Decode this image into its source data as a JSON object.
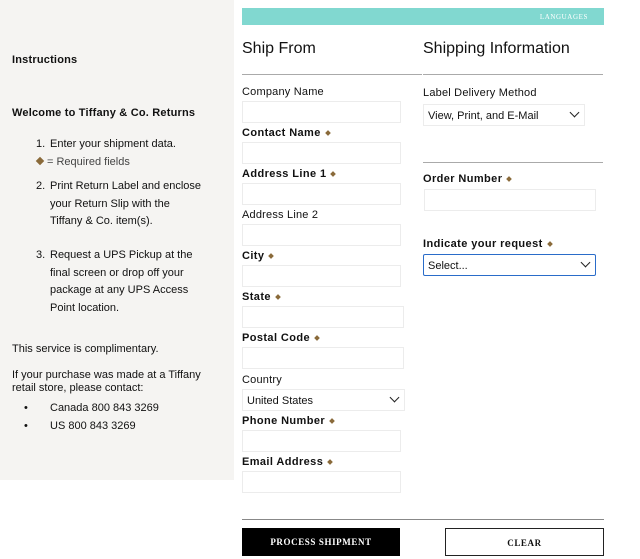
{
  "sidebar": {
    "instructions_title": "Instructions",
    "welcome_title": "Welcome to Tiffany & Co. Returns",
    "steps": [
      {
        "num": "1.",
        "lines": [
          "Enter your shipment data."
        ]
      },
      {
        "num": "2.",
        "lines": [
          "Print Return Label and enclose",
          "your Return Slip with the",
          "Tiffany & Co. item(s)."
        ]
      },
      {
        "num": "3.",
        "lines": [
          "Request a UPS Pickup at the",
          "final screen or drop off your",
          "package at any UPS Access",
          "Point location."
        ]
      }
    ],
    "required_note": "= Required fields",
    "complimentary": "This service is complimentary.",
    "retail_note_line1": "If your purchase was made at a Tiffany",
    "retail_note_line2": "retail store, please contact:",
    "contacts": [
      "Canada 800 843 3269",
      "US 800 843 3269"
    ]
  },
  "topbar": {
    "languages_label": "LANGUAGES",
    "color": "#81d8d0"
  },
  "ship_from": {
    "title": "Ship From",
    "company_name_label": "Company Name",
    "contact_name_label": "Contact Name",
    "address1_label": "Address Line 1",
    "address2_label": "Address Line 2",
    "city_label": "City",
    "state_label": "State",
    "postal_label": "Postal Code",
    "country_label": "Country",
    "country_value": "United States",
    "phone_label": "Phone Number",
    "email_label": "Email Address"
  },
  "shipping_info": {
    "title": "Shipping Information",
    "label_delivery_label": "Label Delivery Method",
    "label_delivery_value": "View, Print, and E-Mail",
    "order_number_label": "Order Number",
    "request_label": "Indicate your request",
    "request_value": "Select..."
  },
  "buttons": {
    "process": "PROCESS SHIPMENT",
    "clear": "CLEAR"
  },
  "colors": {
    "accent_gold": "#8a6a3a",
    "focus_blue": "#2a6cc9",
    "button_dark": "#000000"
  }
}
